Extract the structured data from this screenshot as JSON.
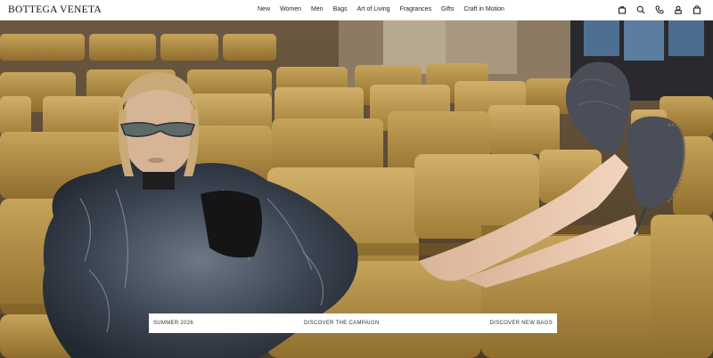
{
  "brand": {
    "logo": "BOTTEGA VENETA"
  },
  "nav": {
    "items": [
      "New",
      "Women",
      "Men",
      "Bags",
      "Art of Living",
      "Fragrances",
      "Gifts",
      "Craft in Motion"
    ]
  },
  "header_icons": [
    "store-icon",
    "search-icon",
    "phone-icon",
    "account-icon",
    "shopping-bag-icon"
  ],
  "hero": {
    "season": "SUMMER 2026",
    "campaign_link": "DISCOVER THE CAMPAIGN",
    "bags_link": "DISCOVER NEW BAGS"
  },
  "colors": {
    "seat": "#b08d3d",
    "seat_shadow": "#8a6a2a",
    "fur": "#3c4652",
    "slipper": "#4a4e58",
    "skin": "#e8c7ab"
  }
}
